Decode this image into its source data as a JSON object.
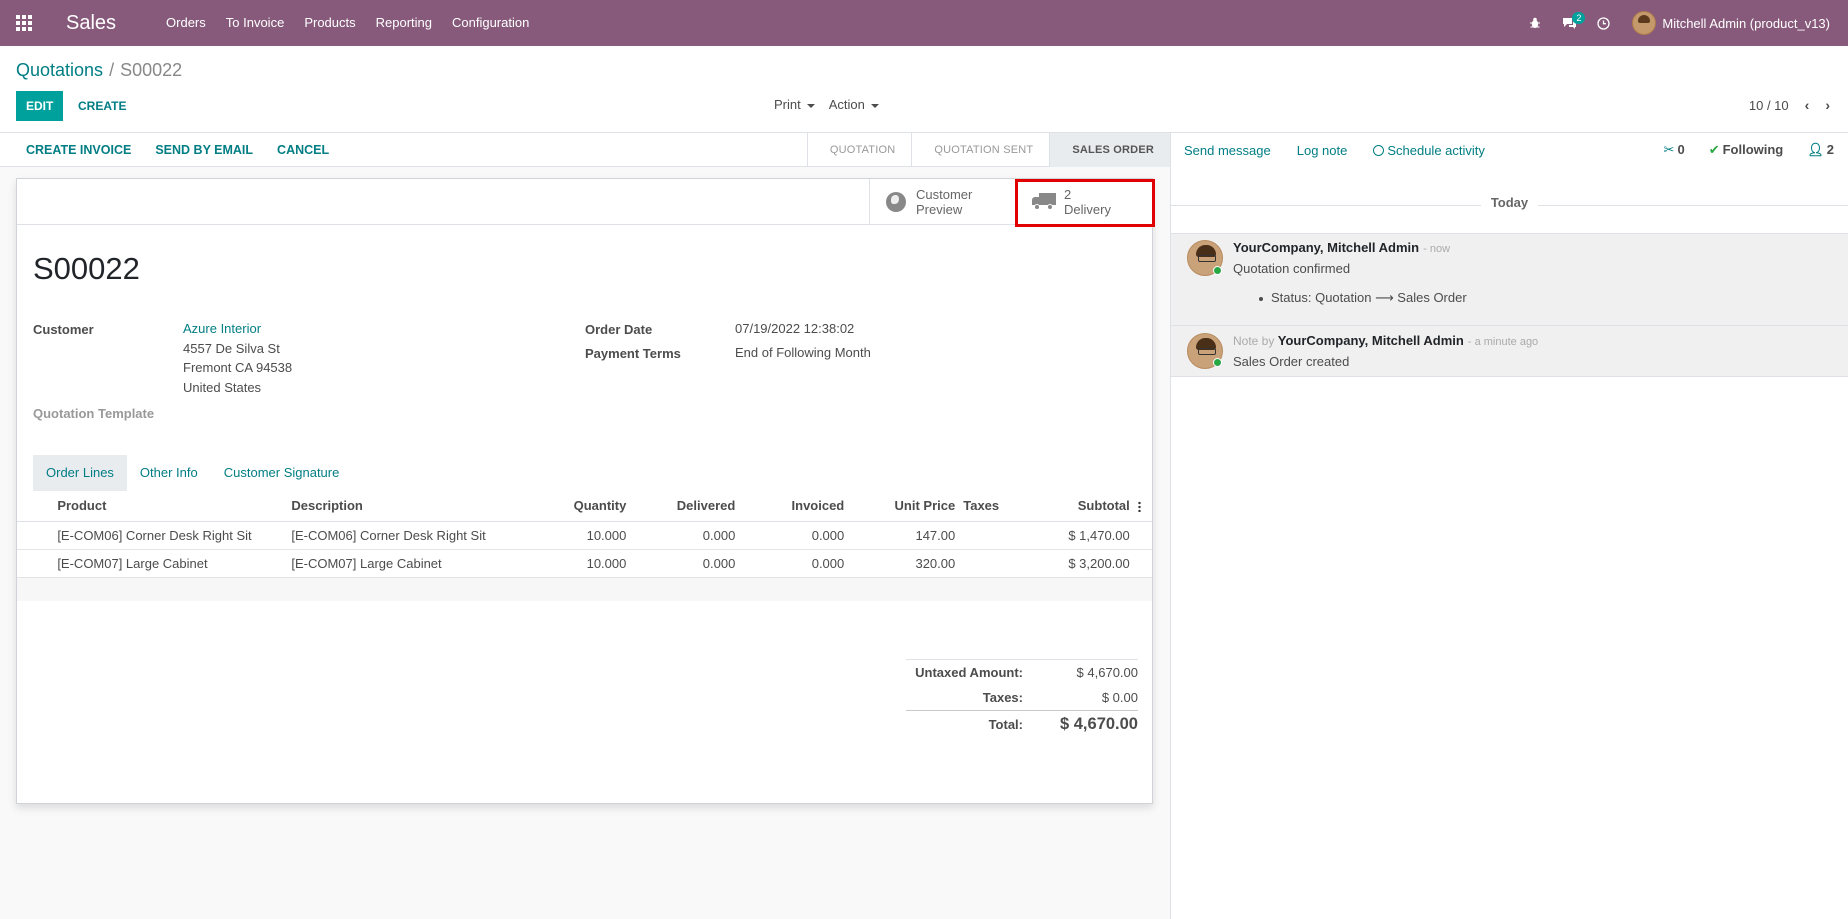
{
  "navbar": {
    "app_name": "Sales",
    "menu": [
      "Orders",
      "To Invoice",
      "Products",
      "Reporting",
      "Configuration"
    ],
    "messages_count": "2",
    "user_name": "Mitchell Admin (product_v13)",
    "icons": {
      "apps": "apps-grid-icon",
      "debug": "bug-icon",
      "messages": "comments-icon",
      "activities": "clock-icon"
    },
    "color": "#875a7b"
  },
  "breadcrumb": {
    "parent": "Quotations",
    "current": "S00022"
  },
  "control": {
    "edit_label": "EDIT",
    "create_label": "CREATE",
    "print_label": "Print",
    "action_label": "Action",
    "pager": "10 / 10"
  },
  "statusbar": {
    "buttons": [
      "CREATE INVOICE",
      "SEND BY EMAIL",
      "CANCEL"
    ],
    "states": [
      "QUOTATION",
      "QUOTATION SENT",
      "SALES ORDER"
    ],
    "active_state": "SALES ORDER"
  },
  "button_box": {
    "preview": {
      "line1": "Customer",
      "line2": "Preview"
    },
    "delivery": {
      "count": "2",
      "label": "Delivery"
    }
  },
  "order": {
    "name": "S00022",
    "customer_label": "Customer",
    "customer_name": "Azure Interior",
    "address": [
      "4557 De Silva St",
      "Fremont CA 94538",
      "United States"
    ],
    "template_label": "Quotation Template",
    "order_date_label": "Order Date",
    "order_date": "07/19/2022 12:38:02",
    "payment_terms_label": "Payment Terms",
    "payment_terms": "End of Following Month"
  },
  "tabs": [
    "Order Lines",
    "Other Info",
    "Customer Signature"
  ],
  "lines": {
    "headers": [
      "Product",
      "Description",
      "Quantity",
      "Delivered",
      "Invoiced",
      "Unit Price",
      "Taxes",
      "Subtotal"
    ],
    "rows": [
      {
        "product": "[E-COM06] Corner Desk Right Sit",
        "description": "[E-COM06] Corner Desk Right Sit",
        "quantity": "10.000",
        "delivered": "0.000",
        "invoiced": "0.000",
        "unit_price": "147.00",
        "taxes": "",
        "subtotal": "$ 1,470.00"
      },
      {
        "product": "[E-COM07] Large Cabinet",
        "description": "[E-COM07] Large Cabinet",
        "quantity": "10.000",
        "delivered": "0.000",
        "invoiced": "0.000",
        "unit_price": "320.00",
        "taxes": "",
        "subtotal": "$ 3,200.00"
      }
    ]
  },
  "totals": {
    "untaxed_label": "Untaxed Amount:",
    "untaxed": "$ 4,670.00",
    "taxes_label": "Taxes:",
    "taxes": "$ 0.00",
    "total_label": "Total:",
    "total": "$ 4,670.00"
  },
  "chatter": {
    "send_message": "Send message",
    "log_note": "Log note",
    "schedule_activity": "Schedule activity",
    "attachments": "0",
    "following": "Following",
    "followers": "2",
    "day": "Today",
    "messages": [
      {
        "author": "YourCompany, Mitchell Admin",
        "date": "- now",
        "body": "Quotation confirmed",
        "tracking": "Status: Quotation ⟶ Sales Order"
      },
      {
        "prefix": "Note by",
        "author": "YourCompany, Mitchell Admin",
        "date": "- a minute ago",
        "body": "Sales Order created"
      }
    ]
  }
}
